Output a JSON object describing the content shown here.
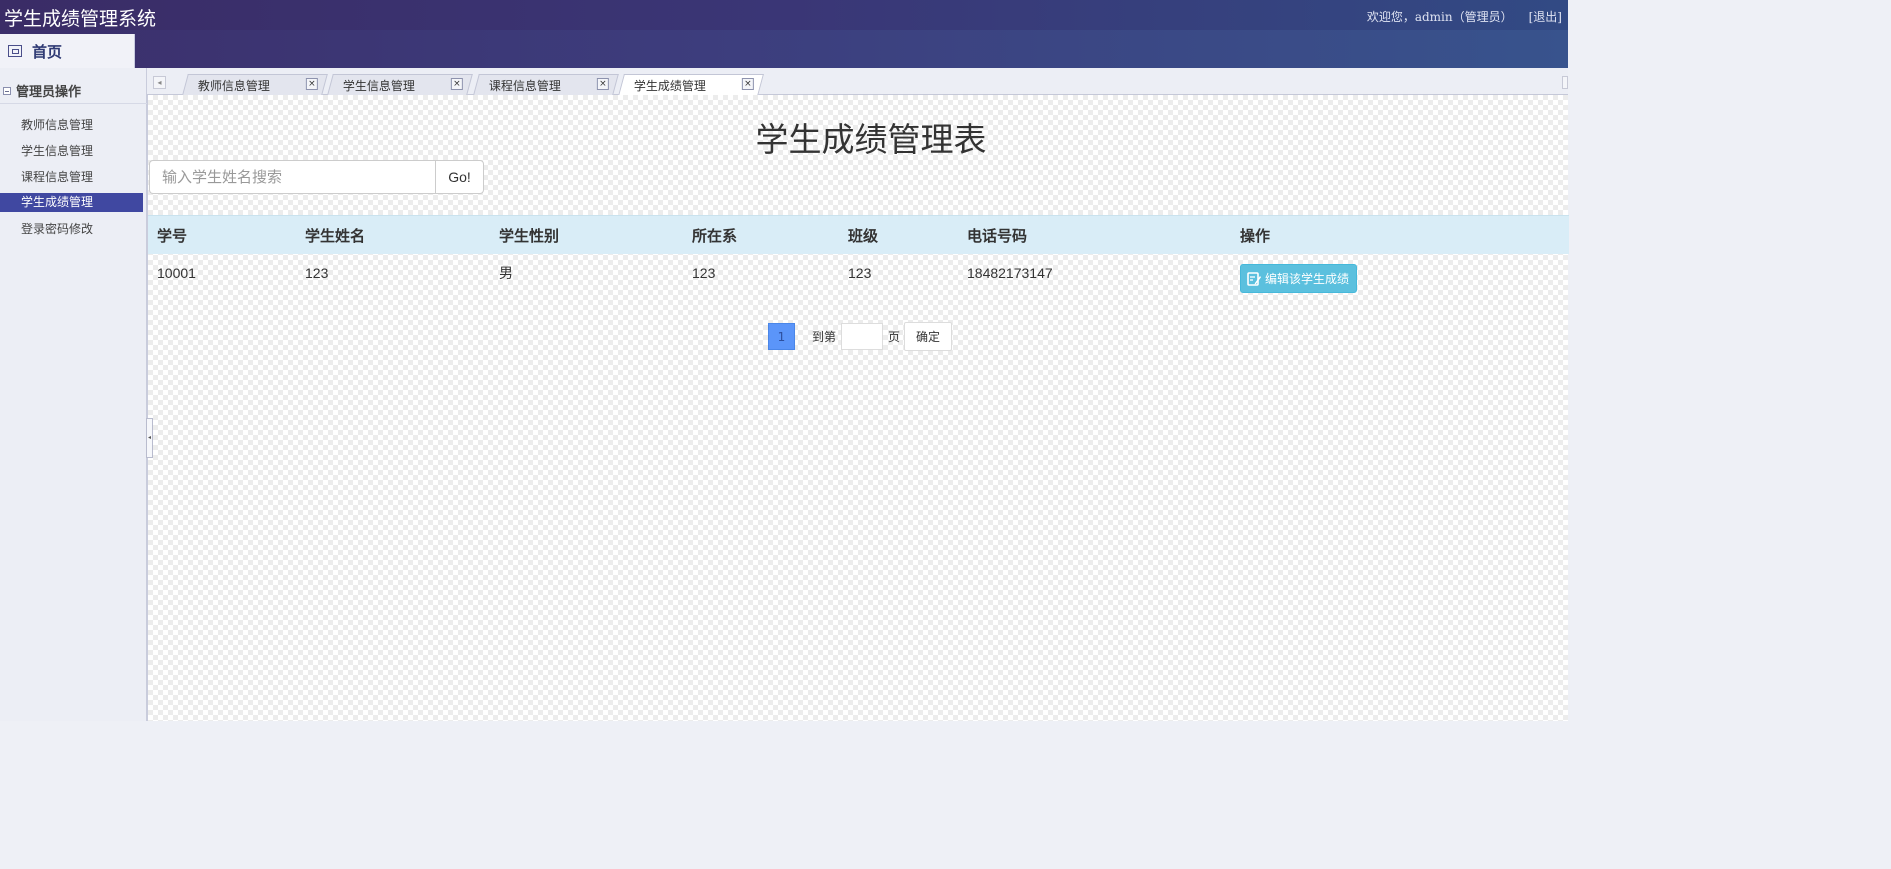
{
  "header": {
    "app_title": "学生成绩管理系统",
    "welcome": "欢迎您，admin（管理员）",
    "logout": "[退出]"
  },
  "home_tab": {
    "label": "首页",
    "icon": "window-icon"
  },
  "sidebar": {
    "section_title": "管理员操作",
    "items": [
      {
        "label": "教师信息管理",
        "active": false
      },
      {
        "label": "学生信息管理",
        "active": false
      },
      {
        "label": "课程信息管理",
        "active": false
      },
      {
        "label": "学生成绩管理",
        "active": true
      },
      {
        "label": "登录密码修改",
        "active": false
      }
    ]
  },
  "tabs": [
    {
      "label": "教师信息管理",
      "close": "×"
    },
    {
      "label": "学生信息管理",
      "close": "×"
    },
    {
      "label": "课程信息管理",
      "close": "×"
    },
    {
      "label": "学生成绩管理",
      "close": "×",
      "active": true
    }
  ],
  "main": {
    "title": "学生成绩管理表",
    "search": {
      "placeholder": "输入学生姓名搜索",
      "button": "Go!"
    },
    "table": {
      "headers": [
        "学号",
        "学生姓名",
        "学生性别",
        "所在系",
        "班级",
        "电话号码",
        "操作"
      ],
      "rows": [
        {
          "id": "10001",
          "name": "123",
          "gender": "男",
          "department": "123",
          "class": "123",
          "phone": "18482173147",
          "action": "编辑该学生成绩"
        }
      ]
    },
    "pagination": {
      "current_page": "1",
      "goto_label": "到第",
      "page_unit": "页",
      "confirm": "确定"
    }
  },
  "colors": {
    "header_start": "#3b2f6b",
    "header_end": "#38538d",
    "active_menu": "#4048a1",
    "table_header": "#d9edf7",
    "edit_button": "#5bc0de",
    "current_page": "#5b95f9"
  }
}
